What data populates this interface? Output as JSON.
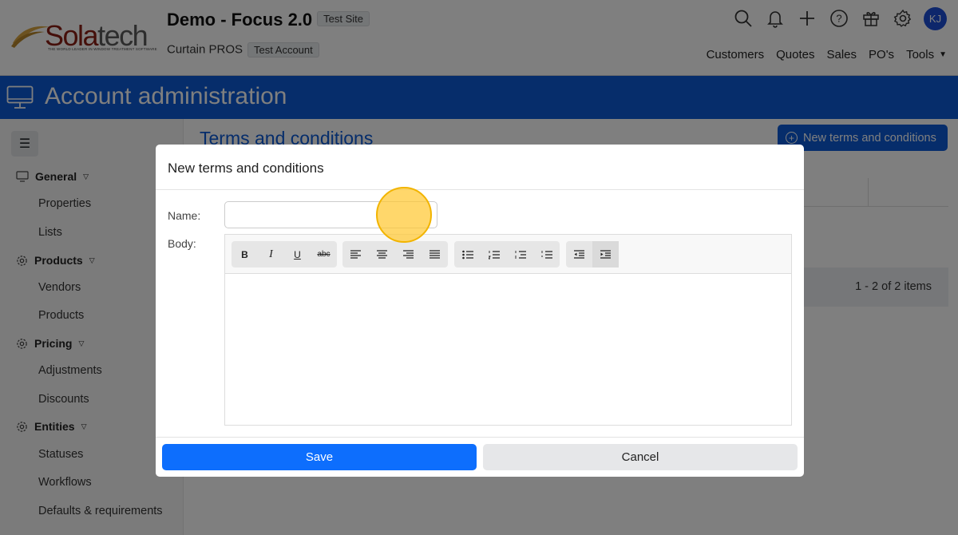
{
  "brand": {
    "word_a": "Sola",
    "word_b": "tech",
    "tagline": "THE WORLD LEADER IN WINDOW TREATMENT SOFTWARE"
  },
  "header": {
    "title": "Demo - Focus 2.0",
    "site_badge": "Test Site",
    "account_name": "Curtain PROS",
    "account_badge": "Test Account",
    "avatar_initials": "KJ",
    "icons": [
      "search-icon",
      "bell-icon",
      "plus-icon",
      "help-icon",
      "gift-icon",
      "gear-icon"
    ],
    "nav": [
      "Customers",
      "Quotes",
      "Sales",
      "PO's",
      "Tools"
    ]
  },
  "banner": {
    "title": "Account administration"
  },
  "sidebar": {
    "groups": [
      {
        "label": "General",
        "items": [
          "Properties",
          "Lists"
        ]
      },
      {
        "label": "Products",
        "items": [
          "Vendors",
          "Products"
        ]
      },
      {
        "label": "Pricing",
        "items": [
          "Adjustments",
          "Discounts"
        ]
      },
      {
        "label": "Entities",
        "items": [
          "Statuses",
          "Workflows",
          "Defaults & requirements"
        ]
      }
    ]
  },
  "main": {
    "title": "Terms and conditions",
    "new_button": "New terms and conditions",
    "pager": "1 - 2 of 2 items"
  },
  "modal": {
    "title": "New terms and conditions",
    "name_label": "Name:",
    "name_value": "",
    "body_label": "Body:",
    "toolbar": {
      "bold": "B",
      "italic": "I",
      "underline": "U",
      "strike": "abc"
    },
    "save_label": "Save",
    "cancel_label": "Cancel"
  },
  "colors": {
    "primary": "#0d5ad6",
    "save": "#0d6efd",
    "accent_click": "#f2b400"
  }
}
